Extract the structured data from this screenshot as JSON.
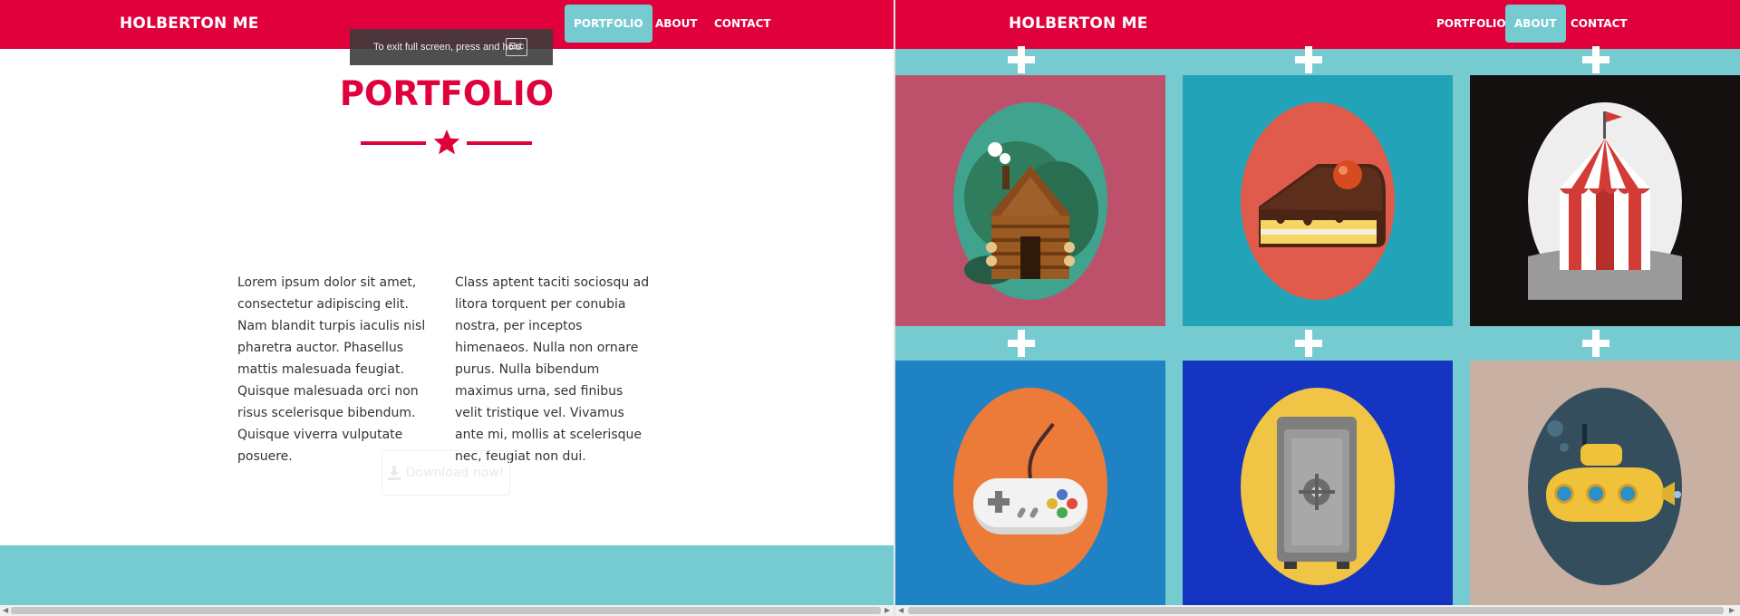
{
  "left_page": {
    "brand": "HOLBERTON ME",
    "nav": [
      {
        "label": "PORTFOLIO",
        "active": true
      },
      {
        "label": "ABOUT",
        "active": false
      },
      {
        "label": "CONTACT",
        "active": false
      }
    ],
    "fullscreen_notice": {
      "text": "To exit full screen, press and hold",
      "key": "Esc"
    },
    "section_title": "PORTFOLIO",
    "separator_icon": "star-icon",
    "columns": [
      "Lorem ipsum dolor sit amet, consectetur adipiscing elit. Nam blandit turpis iaculis nisl pharetra auctor. Phasellus mattis malesuada feugiat. Quisque malesuada orci non risus scelerisque bibendum. Quisque viverra vulputate posuere.",
      "Class aptent taciti sociosqu ad litora torquent per conubia nostra, per inceptos himenaeos. Nulla non ornare purus. Nulla bibendum maximus urna, sed finibus velit tristique vel. Vivamus ante mi, mollis at scelerisque nec, feugiat non dui."
    ],
    "download_button": {
      "label": "Download now!",
      "icon": "download-icon"
    }
  },
  "right_page": {
    "brand": "HOLBERTON ME",
    "nav": [
      {
        "label": "PORTFOLIO",
        "active": false
      },
      {
        "label": "ABOUT",
        "active": true
      },
      {
        "label": "CONTACT",
        "active": false
      }
    ],
    "portfolio_items": [
      {
        "icon": "cabin-icon",
        "background": "#bd516b",
        "circle": "#3fa38e"
      },
      {
        "icon": "cake-icon",
        "background": "#22a3b7",
        "circle": "#e05b4b"
      },
      {
        "icon": "circus-tent-icon",
        "background": "#151010",
        "circle": "#eeeeee"
      },
      {
        "icon": "game-controller-icon",
        "background": "#1f82c5",
        "circle": "#ec7a38"
      },
      {
        "icon": "safe-icon",
        "background": "#1434c1",
        "circle": "#f0c445"
      },
      {
        "icon": "submarine-icon",
        "background": "#c8b0a3",
        "circle": "#344e5e"
      }
    ],
    "hover_icon": "plus-icon"
  },
  "colors": {
    "primary": "#e0003c",
    "accent": "#76cbd1",
    "text": "#333333"
  }
}
